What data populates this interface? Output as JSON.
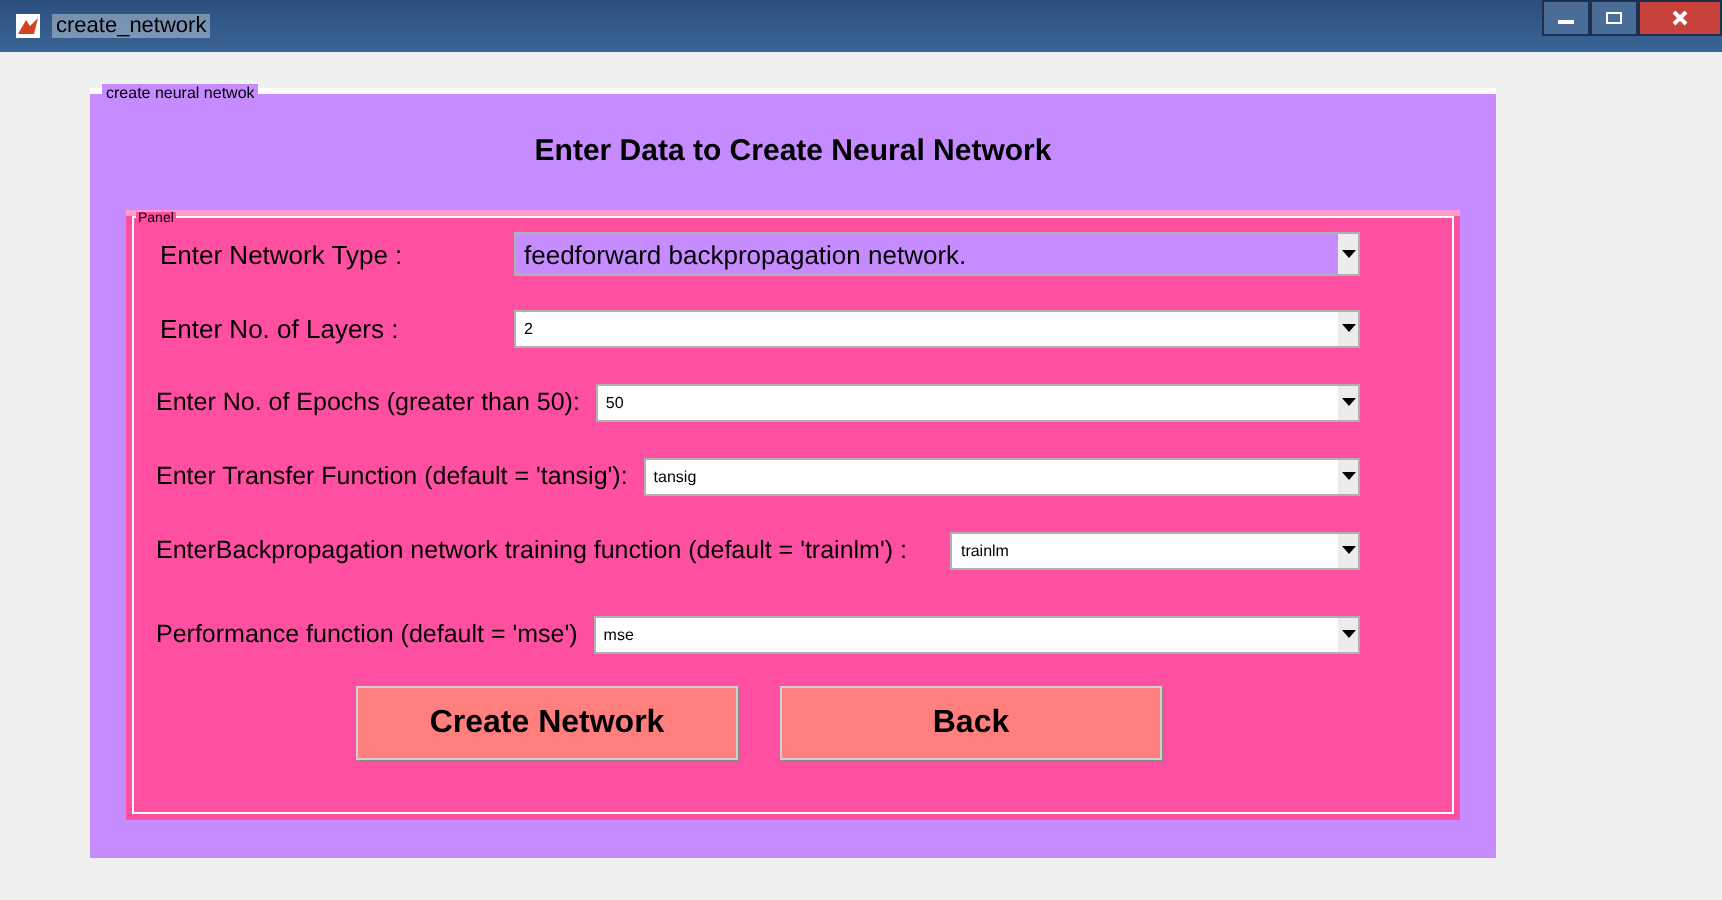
{
  "window": {
    "title": "create_network"
  },
  "group": {
    "label": "create neural netwok",
    "heading": "Enter Data to Create Neural Network"
  },
  "panel": {
    "label": "Panel"
  },
  "fields": [
    {
      "label": "Enter Network Type :",
      "value": "feedforward backpropagation network.",
      "kind": "large"
    },
    {
      "label": "Enter No. of Layers :",
      "value": "2",
      "kind": "small"
    },
    {
      "label": "Enter No. of Epochs (greater than 50):",
      "value": "50",
      "kind": "small"
    },
    {
      "label": "Enter Transfer Function (default = 'tansig'):",
      "value": "tansig",
      "kind": "small"
    },
    {
      "label": "EnterBackpropagation network training function (default = 'trainlm') :",
      "value": "trainlm",
      "kind": "small"
    },
    {
      "label": "Performance function (default = 'mse')",
      "value": "mse",
      "kind": "small"
    }
  ],
  "buttons": [
    "Create Network",
    "Back"
  ]
}
